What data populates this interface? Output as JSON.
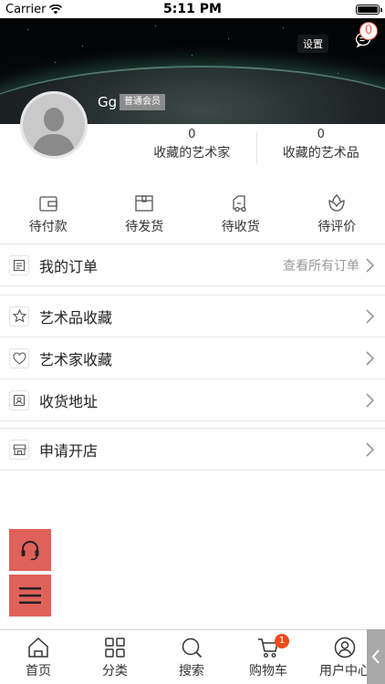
{
  "status_bar": {
    "carrier": "Carrier",
    "time": "5:11 PM"
  },
  "header": {
    "settings_label": "设置",
    "message_count": "0"
  },
  "profile": {
    "username": "Gg",
    "member_level": "普通会员"
  },
  "stats": [
    {
      "value": "0",
      "label": "收藏的艺术家"
    },
    {
      "value": "0",
      "label": "收藏的艺术品"
    }
  ],
  "orders": [
    {
      "label": "待付款",
      "icon": "wallet-icon"
    },
    {
      "label": "待发货",
      "icon": "package-icon"
    },
    {
      "label": "待收货",
      "icon": "truck-icon"
    },
    {
      "label": "待评价",
      "icon": "flower-icon"
    }
  ],
  "my_orders": {
    "label": "我的订单",
    "view_all": "查看所有订单"
  },
  "menu": [
    {
      "label": "艺术品收藏",
      "icon": "star-icon"
    },
    {
      "label": "艺术家收藏",
      "icon": "heart-icon"
    },
    {
      "label": "收货地址",
      "icon": "contact-card-icon"
    },
    {
      "label": "申请开店",
      "icon": "shop-icon"
    }
  ],
  "tabbar": [
    {
      "label": "首页",
      "icon": "home-icon"
    },
    {
      "label": "分类",
      "icon": "grid-icon"
    },
    {
      "label": "搜索",
      "icon": "search-icon"
    },
    {
      "label": "购物车",
      "icon": "cart-icon",
      "badge": "1"
    },
    {
      "label": "用户中心",
      "icon": "user-icon"
    }
  ],
  "colors": {
    "accent": "#e06159",
    "badge": "#f04a1a",
    "text": "#333333",
    "muted": "#999999"
  }
}
